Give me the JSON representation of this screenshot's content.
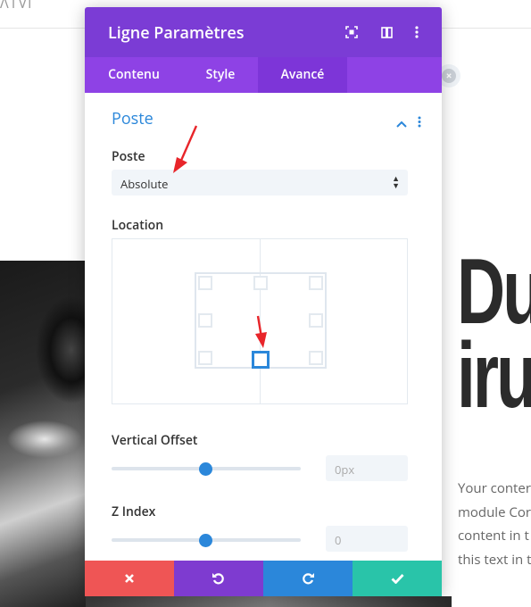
{
  "modal": {
    "title": "Ligne Paramètres",
    "header_icons": [
      "focus-icon",
      "columns-icon",
      "more-icon"
    ]
  },
  "tabs": [
    {
      "label": "Contenu",
      "active": false
    },
    {
      "label": "Style",
      "active": false
    },
    {
      "label": "Avancé",
      "active": true
    }
  ],
  "section": {
    "title": "Poste"
  },
  "position": {
    "label": "Poste",
    "value": "Absolute"
  },
  "location": {
    "label": "Location",
    "selected": "bottom-center"
  },
  "vertical_offset": {
    "label": "Vertical Offset",
    "value": "0px",
    "slider_fraction": 0.5
  },
  "z_index": {
    "label": "Z Index",
    "value": "0",
    "slider_fraction": 0.5
  },
  "background": {
    "heading": "Du\niru",
    "body": "Your conter\nmodule Cor\ncontent in t\nthis text in t"
  },
  "colors": {
    "header": "#7b3cd5",
    "tabs": "#8e42e5",
    "accent": "#2b87da",
    "cancel": "#ef5555",
    "undo": "#7e3bd0",
    "redo": "#2b87da",
    "save": "#29c4a9"
  }
}
